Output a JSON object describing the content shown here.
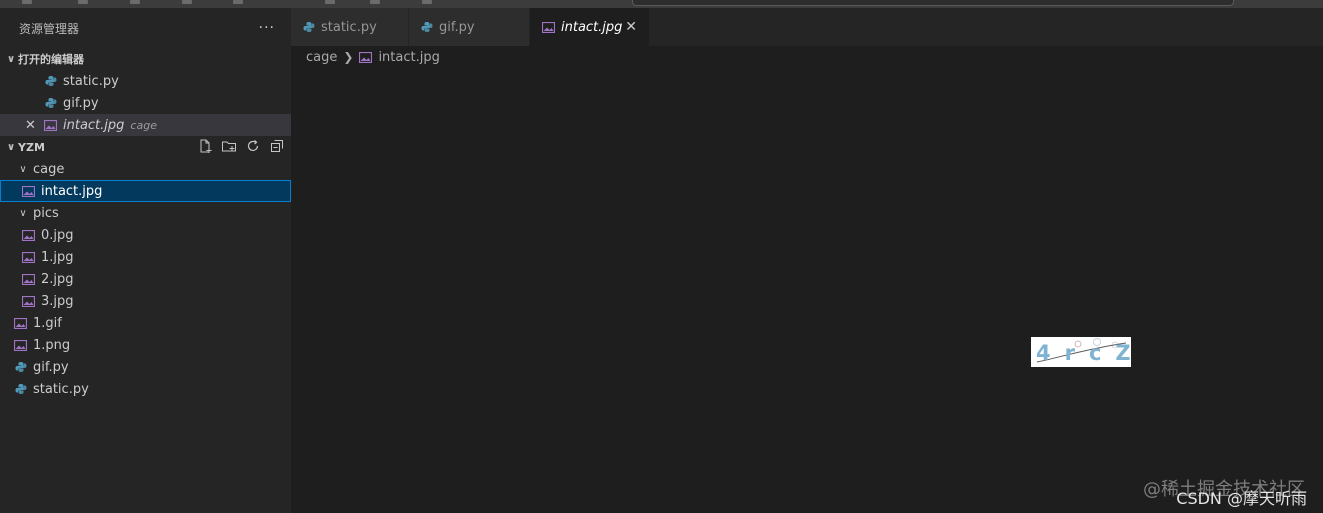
{
  "sidebar": {
    "title": "资源管理器",
    "more_label": "···",
    "open_editors": {
      "title": "打开的编辑器",
      "items": [
        {
          "name": "static.py",
          "icon": "python-file-icon"
        },
        {
          "name": "gif.py",
          "icon": "python-file-icon"
        },
        {
          "name": "intact.jpg",
          "icon": "image-file-icon",
          "description": "cage"
        }
      ]
    },
    "workspace": {
      "title": "YZM",
      "tree": {
        "cage": "cage",
        "cage_intact": "intact.jpg",
        "pics": "pics",
        "pics_0": "0.jpg",
        "pics_1": "1.jpg",
        "pics_2": "2.jpg",
        "pics_3": "3.jpg",
        "root_1gif": "1.gif",
        "root_1png": "1.png",
        "root_gifpy": "gif.py",
        "root_staticpy": "static.py"
      }
    }
  },
  "editor": {
    "tabs": [
      {
        "label": "static.py"
      },
      {
        "label": "gif.py"
      },
      {
        "label": "intact.jpg",
        "active": true
      }
    ],
    "breadcrumb": {
      "folder": "cage",
      "file": "intact.jpg"
    },
    "image_text": "4rcZ"
  },
  "watermark": {
    "line1": "@稀土掘金技术社区",
    "line2": "CSDN @摩天听雨"
  },
  "colors": {
    "selection": "#04395e",
    "focus_border": "#007fd4",
    "python_icon": "#519aba",
    "image_icon": "#a074c4"
  }
}
